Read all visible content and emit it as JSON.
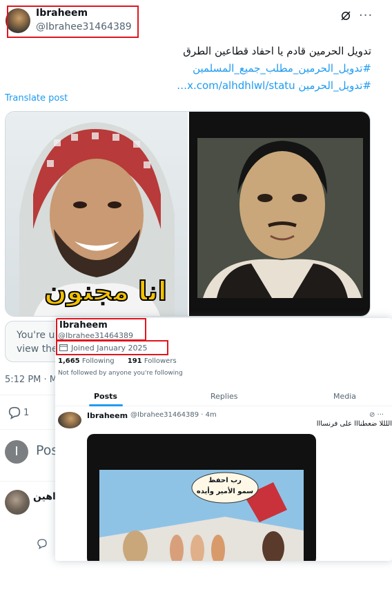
{
  "post": {
    "display_name": "Ibraheem",
    "handle": "@Ibrahee31464389",
    "text_line1": "تدويل الحرمين قادم يا احفاد قطاعين الطرق",
    "hashtag": "#تدويل_الحرمين_مطلب_جميع_المسلمين",
    "link_line": "#تدويل_الحرمين  x.com/alhdhlwl/statu…",
    "translate_label": "Translate post",
    "image_left_caption": "انا مجنون",
    "notice_line1": "You're un",
    "notice_line2": "view thei",
    "timestamp": "5:12 PM · Ma",
    "reply_count": "1",
    "compose_placeholder": "Pos",
    "compose_avatar_letter": "I",
    "reply_author": "اهين"
  },
  "hovercard": {
    "display_name": "Ibraheem",
    "handle": "@Ibrahee31464389",
    "joined": "Joined January 2025",
    "following_count": "1,665",
    "following_label": "Following",
    "followers_count": "191",
    "followers_label": "Followers",
    "not_followed": "Not followed by anyone you're following",
    "tabs": [
      "Posts",
      "Replies",
      "Media"
    ],
    "post_author": "Ibraheem",
    "post_meta": "@Ibrahee31464389 · 4m",
    "post_text": "اللللا ضعطنااا على فرنسااا",
    "image_bubble_line1": "رب احفظ",
    "image_bubble_line2": "سمو الأمير وأيده"
  },
  "colors": {
    "accent": "#1d9bf0",
    "highlight_box": "#e0141e",
    "muted_text": "#536471"
  },
  "icons": [
    "grok-icon",
    "more-icon",
    "reply-icon",
    "calendar-icon"
  ]
}
